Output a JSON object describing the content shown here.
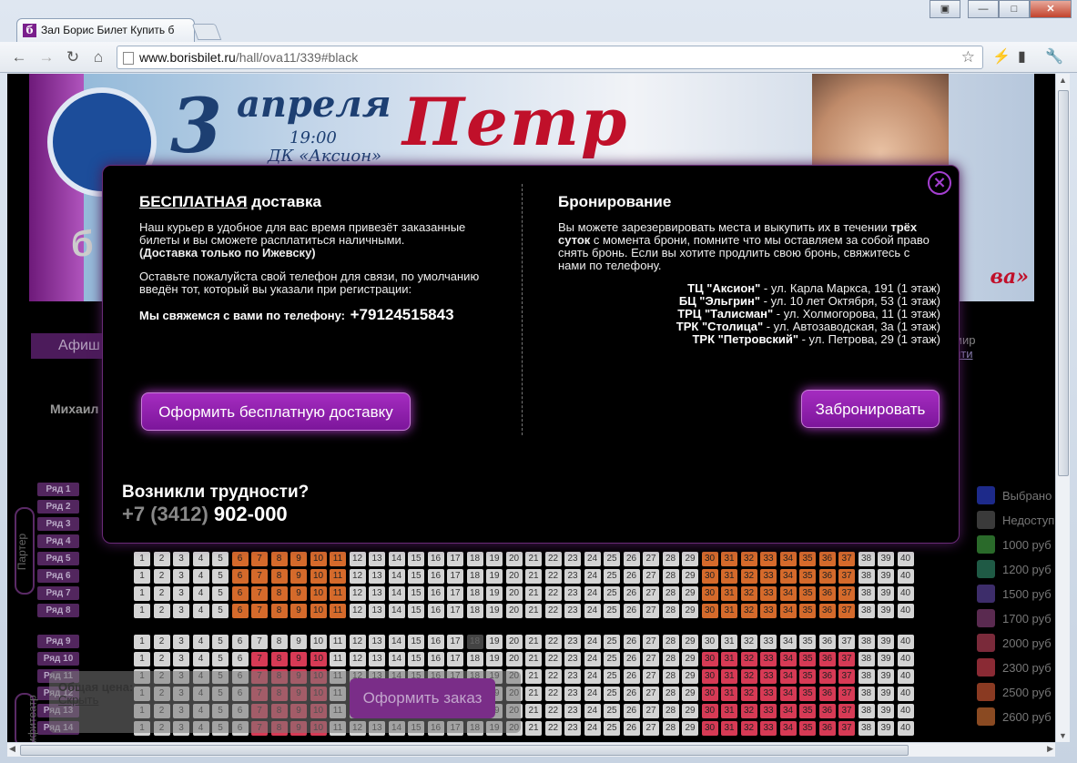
{
  "browser": {
    "tab_title": "Зал Борис Билет Купить б",
    "favicon": "б",
    "url_host": "www.borisbilet.ru",
    "url_path": "/hall/ova11/339#black"
  },
  "banner": {
    "day": "3",
    "month": "апреля",
    "time": "19:00",
    "venue": "ДК «Аксион»",
    "artist": "Петр",
    "slogan": "ва»"
  },
  "nav": {
    "menu_item": "Афиш",
    "user_tail": "мир",
    "user_link": "йти"
  },
  "page_name": "Михаил",
  "modal": {
    "delivery_title_free": "БЕСПЛАТНАЯ",
    "delivery_title_rest": " доставка",
    "delivery_text": "Наш курьер в удобное для вас время привезёт заказанные билеты и вы сможете расплатиться наличными.",
    "delivery_note": "(Доставка только по Ижевску)",
    "phone_prompt": "Оставьте пожалуйста свой телефон для связи, по умолчанию введён тот, который вы указали при регистрации:",
    "contact_label": "Мы свяжемся с вами по телефону:",
    "contact_phone": "+79124515843",
    "delivery_button": "Оформить бесплатную доставку",
    "booking_title": "Бронирование",
    "booking_text_1": "Вы можете зарезервировать места и выкупить их в течении ",
    "booking_text_bold": "трёх суток",
    "booking_text_2": " с момента брони, помните что мы оставляем за собой право снять бронь. Если вы хотите продлить свою бронь, свяжитесь с нами по телефону.",
    "locations": [
      {
        "name": "ТЦ \"Аксион\"",
        "addr": " - ул. Карла Маркса, 191 (1 этаж)"
      },
      {
        "name": "БЦ \"Эльгрин\"",
        "addr": " - ул. 10 лет Октября, 53 (1 этаж)"
      },
      {
        "name": "ТРЦ \"Талисман\"",
        "addr": " - ул. Холмогорова, 11 (1 этаж)"
      },
      {
        "name": "ТРК \"Столица\"",
        "addr": " - ул. Автозаводская, 3а (1 этаж)"
      },
      {
        "name": "ТРК \"Петровский\"",
        "addr": " - ул. Петрова, 29 (1 этаж)"
      }
    ],
    "booking_button": "Забронировать",
    "help_title": "Возникли трудности?",
    "help_phone_prefix": "+7 (3412)",
    "help_phone": "902-000",
    "close_icon": "close-icon"
  },
  "hall": {
    "section_parter": "Партер",
    "section_amphi": "Амфитеатр",
    "rows": [
      "Ряд 1",
      "Ряд 2",
      "Ряд 3",
      "Ряд 4",
      "Ряд 5",
      "Ряд 6",
      "Ряд 7",
      "Ряд 8",
      "Ряд 9",
      "Ряд 10",
      "Ряд 11",
      "Ряд 12",
      "Ряд 13",
      "Ряд 14"
    ]
  },
  "legend": [
    {
      "label": "Выбрано",
      "color": "#1d2a8a"
    },
    {
      "label": "Недоступ",
      "color": "#3a3a3a"
    },
    {
      "label": "1000 руб",
      "color": "#2a6a2a"
    },
    {
      "label": "1200 руб",
      "color": "#1f5a45"
    },
    {
      "label": "1500 руб",
      "color": "#3d2d6a"
    },
    {
      "label": "1700 руб",
      "color": "#5a2a50"
    },
    {
      "label": "2000 руб",
      "color": "#7a2a3a"
    },
    {
      "label": "2300 руб",
      "color": "#8a2a34"
    },
    {
      "label": "2500 руб",
      "color": "#8a3a22"
    },
    {
      "label": "2600 руб",
      "color": "#8a4a22"
    }
  ],
  "order": {
    "total_label": "Общая цена:",
    "hide_link": "Скрыть",
    "order_button": "Оформить заказ"
  },
  "colors": {
    "accent": "#9b22b8",
    "orange_seat": "#d56a2b",
    "red_seat": "#d73a55"
  }
}
